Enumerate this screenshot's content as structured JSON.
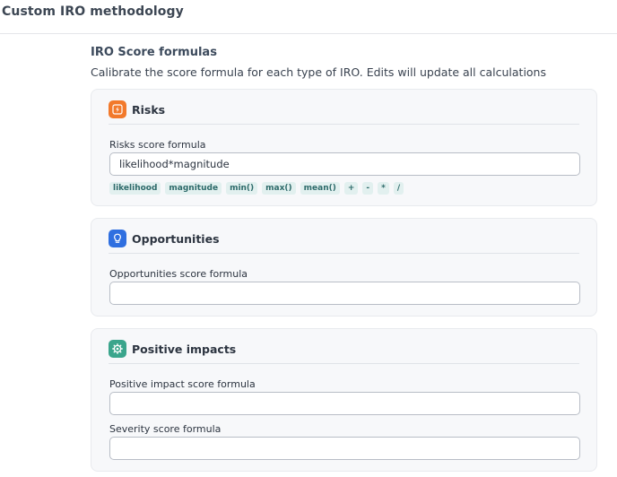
{
  "header": {
    "title": "Custom IRO methodology"
  },
  "section": {
    "title": "IRO Score formulas",
    "description": "Calibrate the score formula for each type of IRO. Edits will update all calculations"
  },
  "risks": {
    "title": "Risks",
    "icon": "lightning-bolt-icon",
    "icon_color": "#f2792b",
    "field_label": "Risks score formula",
    "field_value": "likelihood*magnitude",
    "chips": [
      "likelihood",
      "magnitude",
      "min()",
      "max()",
      "mean()",
      "+",
      "-",
      "*",
      "/"
    ]
  },
  "opportunities": {
    "title": "Opportunities",
    "icon": "lightbulb-icon",
    "icon_color": "#2f6fe0",
    "field_label": "Opportunities score formula",
    "field_value": ""
  },
  "positive_impacts": {
    "title": "Positive impacts",
    "icon": "gear-icon",
    "icon_color": "#3aa58c",
    "field_label": "Positive impact score formula",
    "field_value": "",
    "severity_label": "Severity score formula",
    "severity_value": ""
  }
}
